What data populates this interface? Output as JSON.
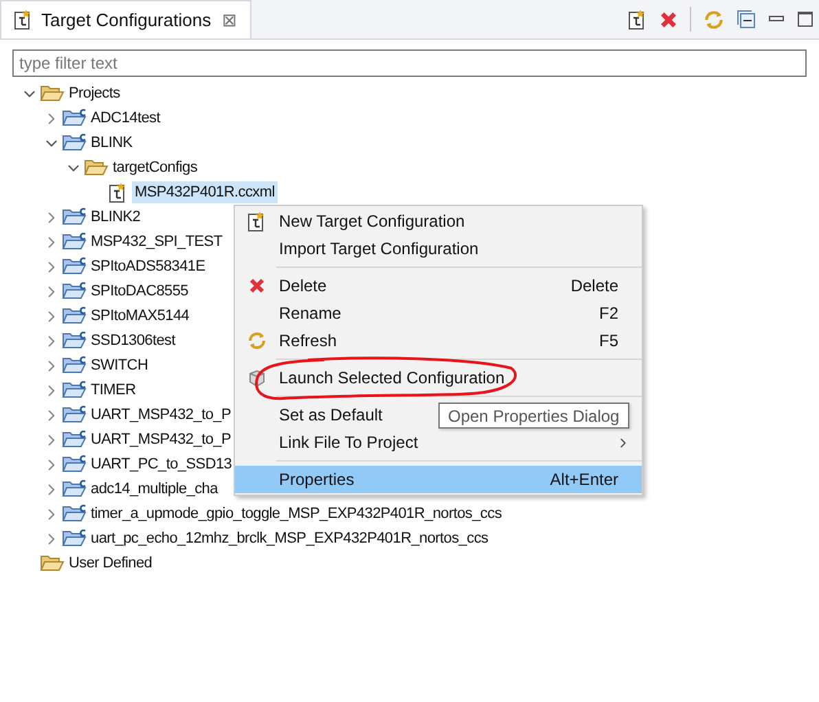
{
  "tab": {
    "title": "Target Configurations",
    "close": "⊠"
  },
  "filter": {
    "placeholder": "type filter text"
  },
  "tree": [
    {
      "kind": "folder",
      "label": "Projects",
      "expanded": true,
      "selected": false,
      "children": [
        {
          "kind": "project",
          "label": "ADC14test",
          "expanded": false,
          "selected": false
        },
        {
          "kind": "project",
          "label": "BLINK",
          "expanded": true,
          "selected": false,
          "children": [
            {
              "kind": "folder",
              "label": "targetConfigs",
              "expanded": true,
              "selected": false,
              "children": [
                {
                  "kind": "file",
                  "label": "MSP432P401R.ccxml",
                  "selected": true
                }
              ]
            }
          ]
        },
        {
          "kind": "project",
          "label": "BLINK2",
          "expanded": false,
          "selected": false
        },
        {
          "kind": "project",
          "label": "MSP432_SPI_TEST",
          "expanded": false,
          "selected": false
        },
        {
          "kind": "project",
          "label": "SPItoADS58341E",
          "expanded": false,
          "selected": false
        },
        {
          "kind": "project",
          "label": "SPItoDAC8555",
          "expanded": false,
          "selected": false
        },
        {
          "kind": "project",
          "label": "SPItoMAX5144",
          "expanded": false,
          "selected": false
        },
        {
          "kind": "project",
          "label": "SSD1306test",
          "expanded": false,
          "selected": false
        },
        {
          "kind": "project",
          "label": "SWITCH",
          "expanded": false,
          "selected": false
        },
        {
          "kind": "project",
          "label": "TIMER",
          "expanded": false,
          "selected": false
        },
        {
          "kind": "project",
          "label": "UART_MSP432_to_P",
          "expanded": false,
          "selected": false
        },
        {
          "kind": "project",
          "label": "UART_MSP432_to_P",
          "expanded": false,
          "selected": false
        },
        {
          "kind": "project",
          "label": "UART_PC_to_SSD13",
          "expanded": false,
          "selected": false
        },
        {
          "kind": "project",
          "label": "adc14_multiple_cha",
          "expanded": false,
          "selected": false
        },
        {
          "kind": "project",
          "label": "timer_a_upmode_gpio_toggle_MSP_EXP432P401R_nortos_ccs",
          "expanded": false,
          "selected": false
        },
        {
          "kind": "project",
          "label": "uart_pc_echo_12mhz_brclk_MSP_EXP432P401R_nortos_ccs",
          "expanded": false,
          "selected": false
        }
      ]
    },
    {
      "kind": "folder",
      "label": "User Defined",
      "selected": false
    }
  ],
  "context_menu": [
    {
      "kind": "item",
      "label": "New Target Configuration",
      "selected": false
    },
    {
      "kind": "item",
      "label": "Import Target Configuration",
      "selected": false
    },
    {
      "kind": "separator"
    },
    {
      "kind": "item",
      "label": "Delete",
      "shortcut": "Delete",
      "selected": false
    },
    {
      "kind": "item",
      "label": "Rename",
      "shortcut": "F2",
      "selected": false
    },
    {
      "kind": "item",
      "label": "Refresh",
      "shortcut": "F5",
      "selected": false
    },
    {
      "kind": "separator"
    },
    {
      "kind": "item",
      "label": "Launch Selected Configuration",
      "selected": false
    },
    {
      "kind": "separator"
    },
    {
      "kind": "item",
      "label": "Set as Default",
      "selected": false
    },
    {
      "kind": "item",
      "label": "Link File To Project",
      "submenu": true,
      "selected": false
    },
    {
      "kind": "separator"
    },
    {
      "kind": "item",
      "label": "Properties",
      "shortcut": "Alt+Enter",
      "selected": true
    }
  ],
  "tooltip": "Open Properties Dialog"
}
